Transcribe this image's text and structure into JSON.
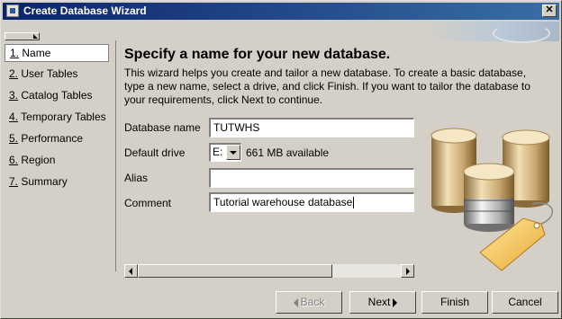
{
  "window": {
    "title": "Create Database Wizard",
    "close_label": "✕"
  },
  "nav": {
    "items": [
      {
        "num": "1.",
        "label": "Name",
        "active": true
      },
      {
        "num": "2.",
        "label": "User Tables"
      },
      {
        "num": "3.",
        "label": "Catalog Tables"
      },
      {
        "num": "4.",
        "label": "Temporary Tables"
      },
      {
        "num": "5.",
        "label": "Performance"
      },
      {
        "num": "6.",
        "label": "Region"
      },
      {
        "num": "7.",
        "label": "Summary"
      }
    ]
  },
  "page": {
    "heading": "Specify a name for your new database.",
    "description": "This wizard helps you create and tailor a new database. To create a basic database, type a new name, select a drive, and click Finish. If you want to tailor the database to your requirements, click Next to continue."
  },
  "form": {
    "database_name_label": "Database name",
    "database_name_value": "TUTWHS",
    "default_drive_label": "Default drive",
    "default_drive_value": "E:",
    "drive_available": "661 MB available",
    "alias_label": "Alias",
    "alias_value": "",
    "comment_label": "Comment",
    "comment_value": "Tutorial warehouse database"
  },
  "buttons": {
    "back": "Back",
    "next": "Next",
    "finish": "Finish",
    "cancel": "Cancel"
  },
  "colors": {
    "titlebar_start": "#0a246a",
    "titlebar_end": "#3a6ea5",
    "face": "#d4d0c8"
  }
}
